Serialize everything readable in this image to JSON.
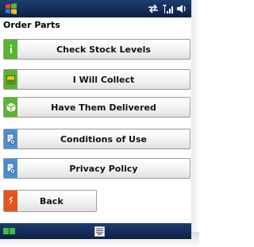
{
  "header": {
    "title": "Order Parts"
  },
  "buttons": [
    {
      "label": "Check Stock Levels",
      "icon": "info-icon"
    },
    {
      "label": "I Will Collect",
      "icon": "collect-icon"
    },
    {
      "label": "Have Them Delivered",
      "icon": "delivery-box-icon"
    },
    {
      "label": "Conditions of Use",
      "icon": "document-icon"
    },
    {
      "label": "Privacy Policy",
      "icon": "document-icon"
    },
    {
      "label": "Back",
      "icon": "back-arrow-icon"
    }
  ],
  "icons": {
    "start": "windows-start-icon",
    "connectivity": "connectivity-arrows-icon",
    "signal": "signal-strength-icon",
    "volume": "volume-icon",
    "soft_left": "soft-key-left-icon",
    "keyboard": "keyboard-icon"
  },
  "colors": {
    "bar": "#0c2146",
    "accent_green": "#58b52e",
    "accent_orange": "#e2561e",
    "accent_blue": "#4b8fd6",
    "button_border": "#9a9a9a"
  }
}
